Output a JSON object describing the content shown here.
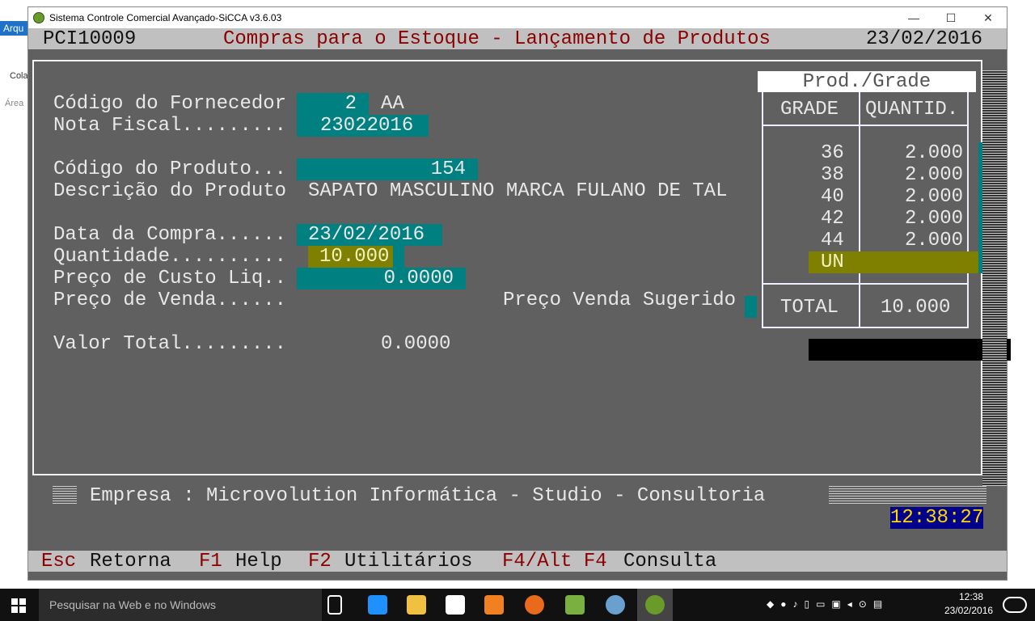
{
  "window": {
    "title": "Sistema Controle Comercial Avançado-SiCCA v3.6.03",
    "minimize": "—",
    "maximize": "☐",
    "close": "✕"
  },
  "background": {
    "menu": "Arqu",
    "paste": "Cola",
    "area": "Área"
  },
  "header": {
    "code": "PCI10009",
    "title": "Compras para o Estoque - Lançamento de Produtos",
    "date": "23/02/2016"
  },
  "form": {
    "fornecedor_label": "Código do Fornecedor",
    "fornecedor_value": "2",
    "fornecedor_name": "AA",
    "nota_label": "Nota Fiscal.........",
    "nota_value": "23022016",
    "produto_label": "Código do Produto...",
    "produto_value": "154",
    "descricao_label": "Descrição do Produto",
    "descricao_value": "SAPATO MASCULINO MARCA FULANO DE TAL",
    "data_label": "Data da Compra......",
    "data_value": "23/02/2016",
    "quantidade_label": "Quantidade..........",
    "quantidade_value": "10.000",
    "custo_label": "Preço de Custo Liq..",
    "custo_value": "0.0000",
    "venda_label": "Preço de Venda......",
    "sugerido_label": "Preço Venda Sugerido",
    "total_label": "Valor Total.........",
    "total_value": "0.0000"
  },
  "grade": {
    "title": "Prod./Grade",
    "col_grade": "GRADE",
    "col_qty": "QUANTID.",
    "rows": [
      {
        "g": "36",
        "q": "2.000"
      },
      {
        "g": "38",
        "q": "2.000"
      },
      {
        "g": "40",
        "q": "2.000"
      },
      {
        "g": "42",
        "q": "2.000"
      },
      {
        "g": "44",
        "q": "2.000"
      }
    ],
    "current": "UN",
    "total_label": "TOTAL",
    "total_value": "10.000"
  },
  "company": "Empresa : Microvolution Informática - Studio - Consultoria",
  "clock": "12:38:27",
  "footer": {
    "esc": "Esc",
    "esc_label": "Retorna",
    "f1": "F1",
    "f1_label": "Help",
    "f2": "F2",
    "f2_label": "Utilitários",
    "f4": "F4/Alt F4",
    "f4_label": "Consulta"
  },
  "taskbar": {
    "search": "Pesquisar na Web e no Windows",
    "time": "12:38",
    "date": "23/02/2016"
  }
}
